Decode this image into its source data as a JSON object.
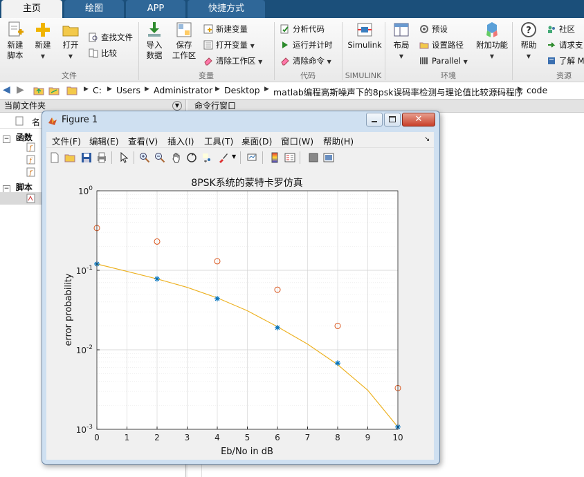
{
  "tabs": [
    "主页",
    "绘图",
    "APP",
    "快捷方式"
  ],
  "ribbon": {
    "new_script": "新建\n脚本",
    "new": "新建",
    "open": "打开",
    "find_files": "查找文件",
    "compare": "比较",
    "import_data": "导入\n数据",
    "save_workspace": "保存\n工作区",
    "new_variable": "新建变量",
    "open_variable": "打开变量",
    "clear_workspace": "清除工作区",
    "analyze_code": "分析代码",
    "run_and_time": "运行并计时",
    "clear_commands": "清除命令",
    "simulink": "Simulink",
    "layout": "布局",
    "preferences": "预设",
    "set_path": "设置路径",
    "parallel": "Parallel",
    "addons": "附加功能",
    "help": "帮助",
    "community": "社区",
    "request_support": "请求支",
    "learn_matlab": "了解 M",
    "group_file": "文件",
    "group_variable": "变量",
    "group_code": "代码",
    "group_simulink": "SIMULINK",
    "group_environment": "环境",
    "group_resources": "资源"
  },
  "address": {
    "path": [
      "C:",
      "Users",
      "Administrator",
      "Desktop",
      "matlab编程高斯噪声下的8psk误码率检测与理论值比较源码程序",
      "code"
    ]
  },
  "left_panel": {
    "title": "当前文件夹",
    "col_name": "名",
    "section_functions": "函数",
    "section_scripts": "脚本"
  },
  "command_window": {
    "title": "命令行窗口"
  },
  "figure": {
    "title": "Figure 1",
    "menu": [
      "文件(F)",
      "编辑(E)",
      "查看(V)",
      "插入(I)",
      "工具(T)",
      "桌面(D)",
      "窗口(W)",
      "帮助(H)"
    ]
  },
  "chart_data": {
    "type": "scatter",
    "title": "8PSK系统的蒙特卡罗仿真",
    "xlabel": "Eb/No in dB",
    "ylabel": "error probability",
    "xlim": [
      0,
      10
    ],
    "ylim": [
      0.001,
      1
    ],
    "yscale": "log",
    "grid": true,
    "x_ticks": [
      "0",
      "1",
      "2",
      "3",
      "4",
      "5",
      "6",
      "7",
      "8",
      "9",
      "10"
    ],
    "y_ticks": [
      {
        "base": "10",
        "exp": "0",
        "value": 1
      },
      {
        "base": "10",
        "exp": "-1",
        "value": 0.1
      },
      {
        "base": "10",
        "exp": "-2",
        "value": 0.01
      },
      {
        "base": "10",
        "exp": "-3",
        "value": 0.001
      }
    ],
    "series": [
      {
        "marker": "o",
        "color": "#d95319",
        "x": [
          0,
          2,
          4,
          6,
          8,
          10
        ],
        "y": [
          0.34,
          0.23,
          0.13,
          0.057,
          0.02,
          0.0033
        ]
      },
      {
        "marker": "*",
        "color": "#0072bd",
        "x": [
          0,
          2,
          4,
          6,
          8,
          10
        ],
        "y": [
          0.12,
          0.078,
          0.044,
          0.019,
          0.0068,
          0.00107
        ]
      },
      {
        "marker": "line",
        "color": "#edb120",
        "x": [
          0,
          1,
          2,
          3,
          4,
          5,
          6,
          7,
          8,
          9,
          10
        ],
        "y": [
          0.12,
          0.097,
          0.078,
          0.061,
          0.045,
          0.031,
          0.0195,
          0.0118,
          0.0065,
          0.0031,
          0.00107
        ]
      }
    ]
  }
}
